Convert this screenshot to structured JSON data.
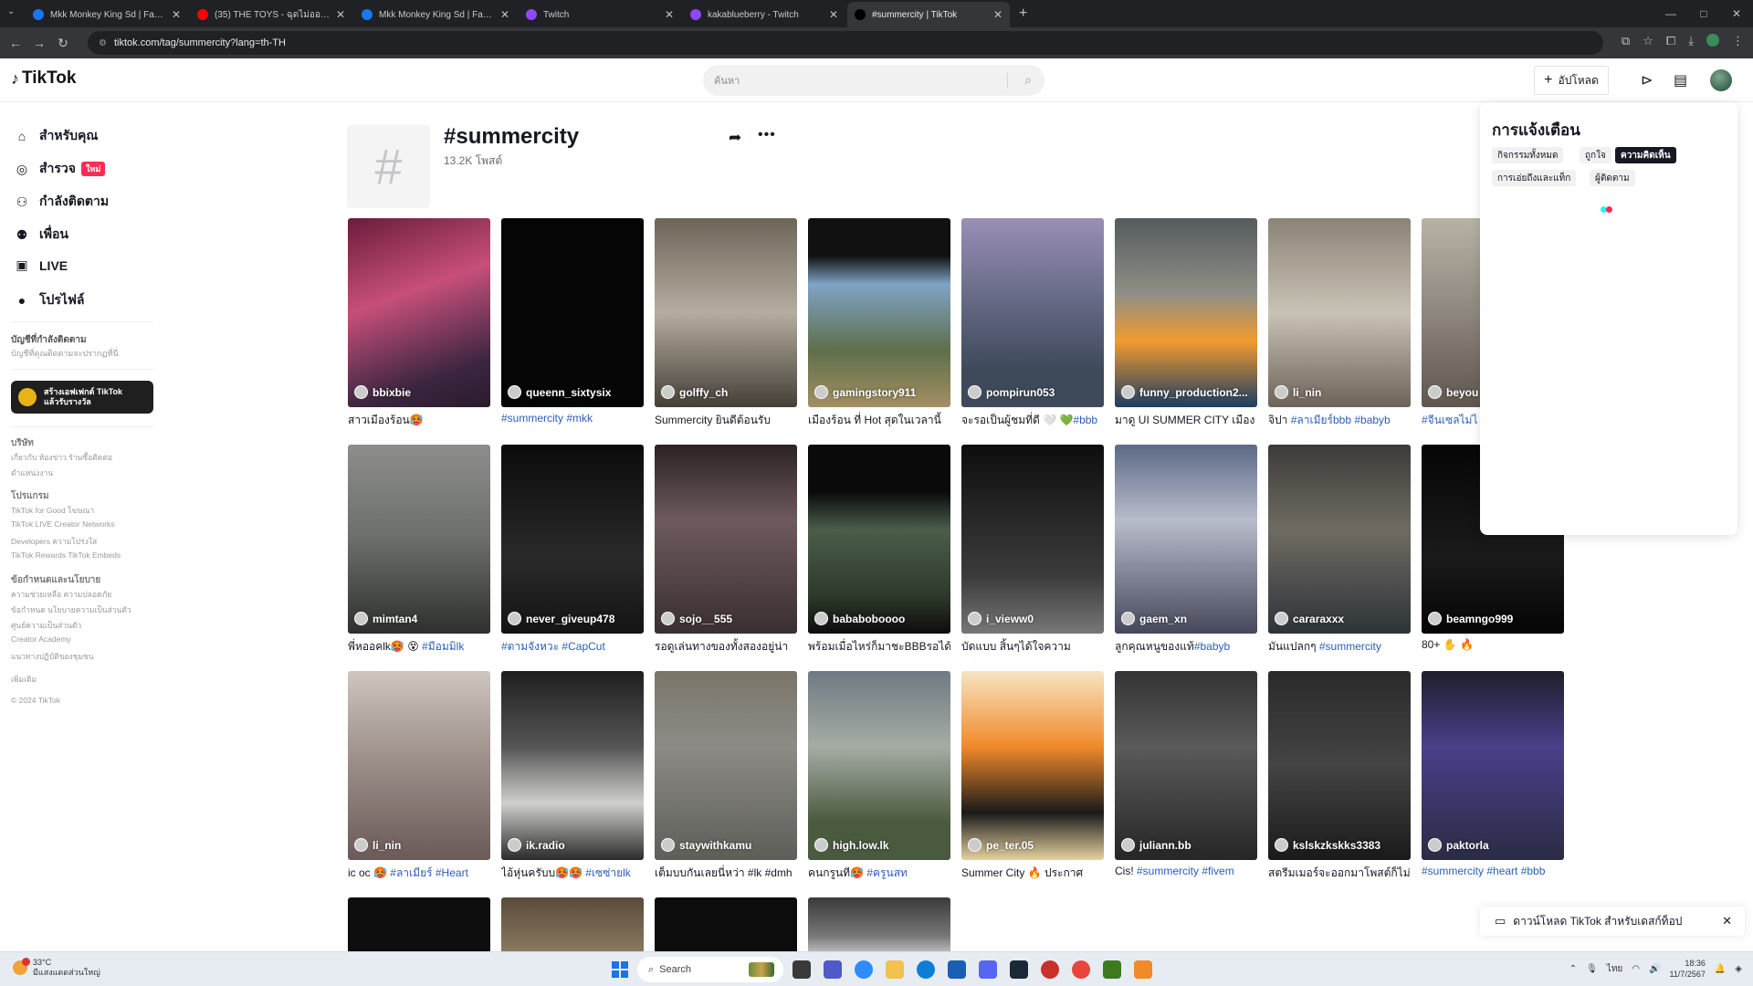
{
  "browser": {
    "tabs": [
      {
        "title": "Mkk Monkey King Sd | Facebo",
        "fav_color": "#1877f2",
        "active": false
      },
      {
        "title": "(35) THE TOYS - ฉุดไม่ออก (JUST",
        "fav_color": "#ff0000",
        "active": false
      },
      {
        "title": "Mkk Monkey King Sd | Faceboo",
        "fav_color": "#1877f2",
        "active": false
      },
      {
        "title": "Twitch",
        "fav_color": "#9146ff",
        "active": false
      },
      {
        "title": "kakablueberry - Twitch",
        "fav_color": "#9146ff",
        "active": false
      },
      {
        "title": "#summercity | TikTok",
        "fav_color": "#000000",
        "active": true
      }
    ],
    "url": "tiktok.com/tag/summercity?lang=th-TH",
    "window_controls": [
      "—",
      "□",
      "✕"
    ]
  },
  "header": {
    "logo_text": "TikTok",
    "search_placeholder": "ค้นหา",
    "upload_label": "อัปโหลด"
  },
  "sidebar": {
    "nav": [
      {
        "label": "สำหรับคุณ",
        "icon": "home-icon",
        "glyph": "⌂"
      },
      {
        "label": "สำรวจ",
        "icon": "compass-icon",
        "glyph": "◎",
        "badge": "ใหม่"
      },
      {
        "label": "กำลังติดตาม",
        "icon": "following-icon",
        "glyph": "⚇"
      },
      {
        "label": "เพื่อน",
        "icon": "friends-icon",
        "glyph": "⚉"
      },
      {
        "label": "LIVE",
        "icon": "live-icon",
        "glyph": "▣"
      },
      {
        "label": "โปรไฟล์",
        "icon": "profile-icon",
        "glyph": "●"
      }
    ],
    "following_heading": "บัญชีที่กำลังติดตาม",
    "following_sub": "บัญชีที่คุณติดตามจะปรากฏที่นี่",
    "effect_button": "สร้างเอฟเฟกต์ TikTok\nแล้วรับรางวัล",
    "footer": [
      {
        "head": "บริษัท",
        "lines": [
          "เกี่ยวกับ  ห้องข่าว  ร้านซื้อติดต่อ",
          "ตำแหน่งงาน"
        ]
      },
      {
        "head": "โปรแกรม",
        "lines": [
          "TikTok for Good  โฆษณา",
          "TikTok LIVE Creator Networks",
          "Developers  ความโปร่งใส",
          "TikTok Rewards  TikTok Embeds"
        ]
      },
      {
        "head": "ข้อกำหนดและนโยบาย",
        "lines": [
          "ความช่วยเหลือ  ความปลอดภัย",
          "ข้อกำหนด  นโยบายความเป็นส่วนตัว",
          "ศูนย์ความเป็นส่วนตัว",
          "Creator Academy",
          "แนวทางปฏิบัติของชุมชน"
        ]
      },
      {
        "head": "",
        "lines": [
          "เพิ่มเติม"
        ]
      },
      {
        "head": "",
        "lines": [
          "© 2024 TikTok"
        ]
      }
    ]
  },
  "hashtag": {
    "title": "#summercity",
    "post_count": "13.2K โพสต์"
  },
  "videos": [
    {
      "user": "bbixbie",
      "caption": "สาวเมืองร้อน🥵",
      "tag": "",
      "bg": "linear-gradient(160deg,#6b1c3c,#c74f7a 40%,#3b2540 80%,#2a1c2c)"
    },
    {
      "user": "queenn_sixtysix",
      "caption": "",
      "tag": "#summercity #mkk",
      "bg": "#050505"
    },
    {
      "user": "golffy_ch",
      "caption": "Summercity ยินดีต้อนรับ",
      "tag": "",
      "bg": "linear-gradient(180deg,#6c6558,#b5ada0 50%,#453f36)"
    },
    {
      "user": "gamingstory911",
      "caption": "เมืองร้อน ที่ Hot สุดในเวลานี้",
      "tag": "",
      "bg": "linear-gradient(180deg,#111 0%,#111 20%,#7fa4c6 35%,#5e6f4a 70%,#a38f63)"
    },
    {
      "user": "pompirun053",
      "caption": "จะรอเป็นผู้ชมที่ดี 🤍 💚",
      "tag": "#bbb",
      "bg": "linear-gradient(180deg,#9a8fb4,#6a6c8a 40%,#3e4a5a 80%)"
    },
    {
      "user": "funny_production2...",
      "caption": "มาดู UI SUMMER CITY เมือง",
      "tag": "",
      "bg": "linear-gradient(180deg,#555b5e,#8e8f86 40%,#f29a2e 65%,#1b3e63)"
    },
    {
      "user": "li_nin",
      "caption": "จิปา ",
      "tag": "#ลาเมียร์bbb #babyb",
      "bg": "linear-gradient(180deg,#8a8376,#c9c3b6 50%,#6e6257)"
    },
    {
      "user": "beyou",
      "caption": "",
      "tag": "#จีนเซลไม่ไ",
      "bg": "linear-gradient(180deg,#b7b2a6,#8e877e 50%,#5e564f)"
    },
    {
      "user": "mimtan4",
      "caption": "พี่หออคlk🥵 😵 ",
      "tag": "#มีอมมิlk",
      "bg": "linear-gradient(180deg,#8d8e8c,#6c6e6a 50%,#2e302d)"
    },
    {
      "user": "never_giveup478",
      "caption": "",
      "tag": "#ตามจังหวะ #CapCut",
      "bg": "linear-gradient(180deg,#0b0b0b,#2a2a2a 60%,#141414)"
    },
    {
      "user": "sojo__555",
      "caption": "รอดูเล่นทางของทั้งสองอยู่น่า",
      "tag": "",
      "bg": "linear-gradient(180deg,#2a2224,#6e5a5c 40%,#3a2f31)"
    },
    {
      "user": "bababoboooo",
      "caption": "พร้อมเมื่อไหร่ก็มาชะBBBรอได้",
      "tag": "",
      "bg": "linear-gradient(180deg,#0a0a0a,#0a0a0a 25%,#4b5e4a 45%,#2d3a2a 80%,#0d0d0d)"
    },
    {
      "user": "i_vieww0",
      "caption": "บัดแบบ สิ้นๆได้ใจความ",
      "tag": "",
      "bg": "linear-gradient(180deg,#0d0d0d,#3c3c3c 70%,#777)"
    },
    {
      "user": "gaem_xn",
      "caption": "ลูกคุณหนูของแท้",
      "tag": "#babyb",
      "bg": "linear-gradient(180deg,#5c6a86,#b8bccb 40%,#44485a)"
    },
    {
      "user": "cararaxxx",
      "caption": "มันแปลกๆ ",
      "tag": "#summercity",
      "bg": "linear-gradient(180deg,#3c3b39,#6f6b62 45%,#2d3439)"
    },
    {
      "user": "beamngo999",
      "caption": "80+ ✋ 🔥",
      "tag": "",
      "bg": "linear-gradient(180deg,#060606,#1a1a1a 60%,#050505)"
    },
    {
      "user": "li_nin",
      "caption": "ic oc 🥵 ",
      "tag": "#ลาเมียร์ #Heart",
      "bg": "linear-gradient(180deg,#cfc6bf,#a39790 40%,#6b5a58)"
    },
    {
      "user": "ik.radio",
      "caption": "ไอ้หุ่นครับบ🥵🥵 ",
      "tag": "#เซซ่ายlk",
      "bg": "linear-gradient(180deg,#1e1e1e,#555 40%,#cfd0cc 70%,#2a2a2a)"
    },
    {
      "user": "staywithkamu",
      "caption": "เต็มบบกันเลยนี่หว่า #lk #dmh",
      "tag": "",
      "bg": "linear-gradient(180deg,#7a7568,#8c8b86 40%,#5e5e58)"
    },
    {
      "user": "high.low.lk",
      "caption": "คนกรูนที🥵 ",
      "tag": "#ครูนสท",
      "bg": "linear-gradient(180deg,#6e7a84,#a6aca4 40%,#4a5a3e 80%)"
    },
    {
      "user": "pe_ter.05",
      "caption": "Summer City 🔥 ประกาศ",
      "tag": "",
      "bg": "linear-gradient(180deg,#f7e5c2,#f08a2a 40%,#1a1a1a 75%,#e6d2a0)"
    },
    {
      "user": "juliann.bb",
      "caption": "Cis! ",
      "tag": "#summercity #fivem",
      "bg": "linear-gradient(180deg,#333,#5a5a5a 40%,#262626)"
    },
    {
      "user": "kslskzkskks3383",
      "caption": "สตรีมเมอร์จะออกมาโพสต์ก็ไม่",
      "tag": "",
      "bg": "linear-gradient(180deg,#2a2a2a,#444 50%,#1a1a1a)"
    },
    {
      "user": "paktorla",
      "caption": "",
      "tag": "#summercity #heart #bbb",
      "bg": "linear-gradient(180deg,#1d1f2c,#4a3f8a 40%,#2a2c44)"
    }
  ],
  "partial_row": [
    {
      "bg": "#0e0e0e"
    },
    {
      "bg": "linear-gradient(180deg,#5a4a3a,#8a7a60)"
    },
    {
      "bg": "#0c0c0c"
    },
    {
      "bg": "linear-gradient(180deg,#3a3a3a,#777 70%,#bbb)"
    }
  ],
  "notifications": {
    "title": "การแจ้งเตือน",
    "chips": [
      {
        "label": "กิจกรรมทั้งหมด",
        "selected": false
      },
      {
        "label": "ถูกใจ",
        "selected": false
      },
      {
        "label": "ความคิดเห็น",
        "selected": true
      },
      {
        "label": "การเอ่ยถึงและแท็ก",
        "selected": false
      },
      {
        "label": "ผู้ติดตาม",
        "selected": false
      }
    ]
  },
  "download_toast": {
    "text": "ดาวน์โหลด TikTok สำหรับเดสก์ท็อป"
  },
  "taskbar": {
    "weather_temp": "33°C",
    "weather_text": "มีแสงแดดส่วนใหญ่",
    "search_label": "Search",
    "language": "ไทย",
    "time": "18:36",
    "date": "11/7/2567"
  }
}
